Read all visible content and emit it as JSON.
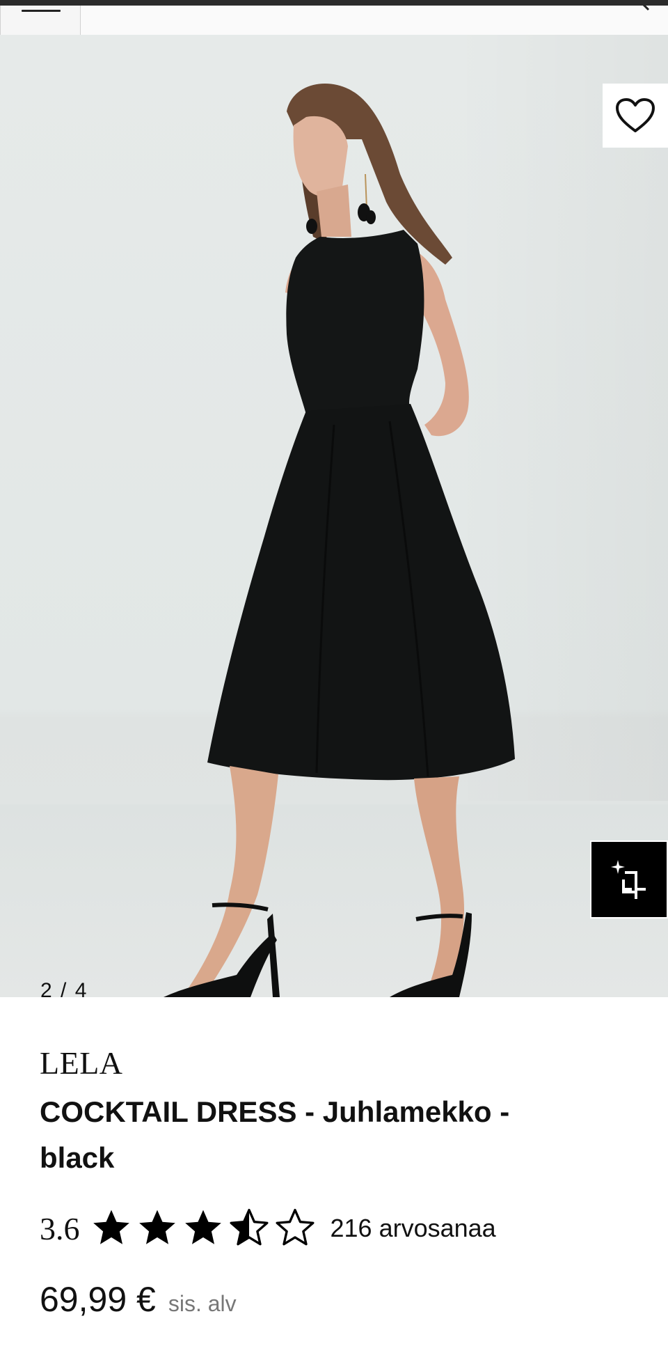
{
  "header": {
    "menu_icon": "hamburger-icon",
    "search_icon": "chevron-icon"
  },
  "gallery": {
    "counter": "2 / 4",
    "wishlist_icon": "heart-icon",
    "zoom_icon": "sparkle-crop-icon",
    "photo_alt": "Model wearing black sleeveless midi cocktail dress with black heeled sandals"
  },
  "product": {
    "brand": "LELA",
    "name": "COCKTAIL DRESS - Juhlamekko - black",
    "rating": {
      "value": "3.6",
      "stars": 3.5,
      "max": 5,
      "count_label": "216 arvosanaa"
    },
    "price": "69,99 €",
    "vat_note": "sis. alv"
  },
  "colors": {
    "accent": "#000000",
    "text": "#111111",
    "muted": "#777777",
    "background": "#e4e8e7"
  }
}
